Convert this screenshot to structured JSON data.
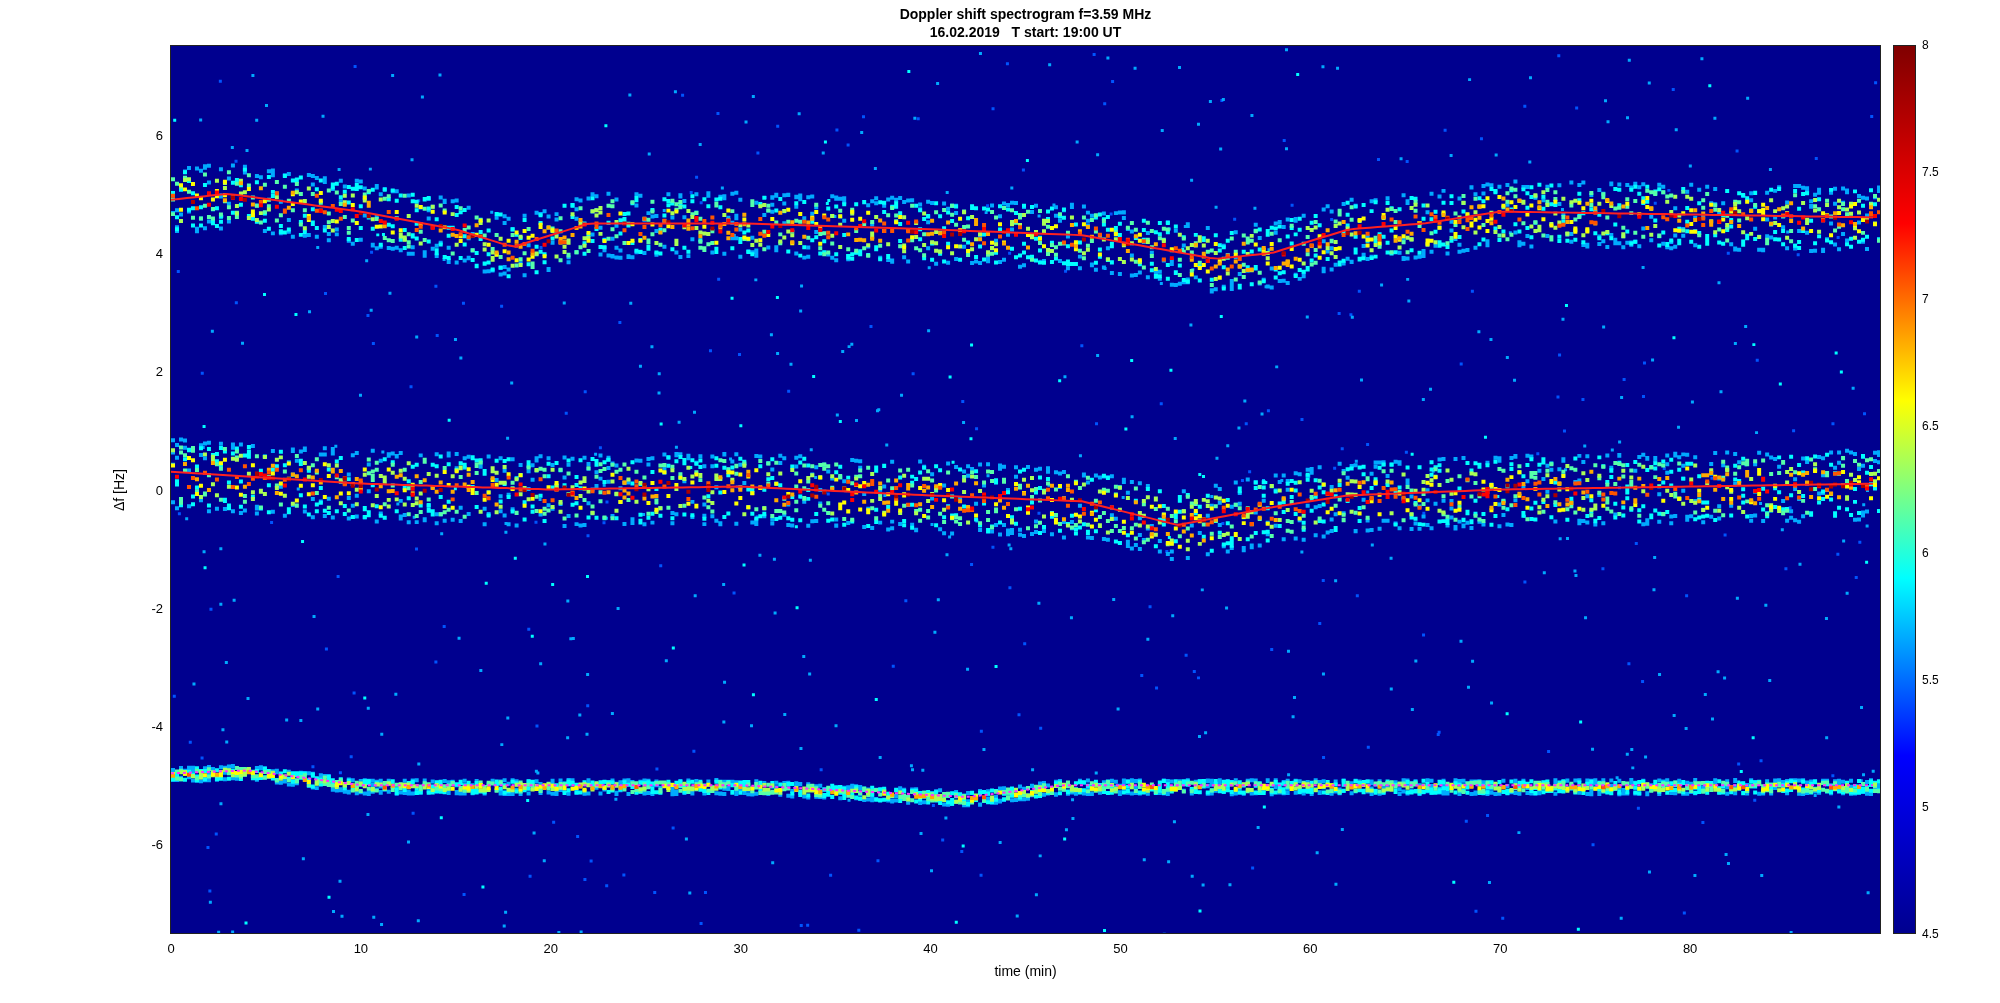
{
  "title": [
    "Doppler shift spectrogram f=3.59 MHz",
    "16.02.2019   T start: 19:00 UT"
  ],
  "ylabel": "Δf [Hz]",
  "yticks": [
    "6",
    "4",
    "2",
    "0",
    "-2",
    "-4",
    "-6"
  ],
  "xticks": [
    "0",
    "10",
    "20",
    "30",
    "40",
    "50",
    "60",
    "70",
    "80"
  ],
  "xlabel": "time (min)",
  "colorbar_ticks": [
    "8",
    "7.5",
    "7",
    "6.5",
    "6",
    "5.5",
    "5",
    "4.5"
  ]
}
